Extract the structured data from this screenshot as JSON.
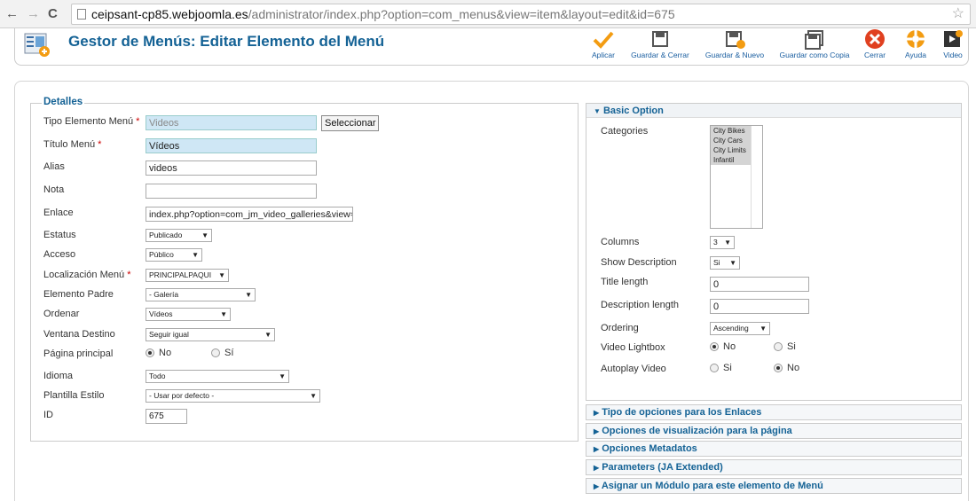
{
  "browser": {
    "url_host": "ceipsant-cp85.webjoomla.es",
    "url_path": "/administrator/index.php?option=com_menus&view=item&layout=edit&id=675"
  },
  "header": {
    "title": "Gestor de Menús: Editar Elemento del Menú",
    "toolbar": {
      "apply": "Aplicar",
      "save_close": "Guardar & Cerrar",
      "save_new": "Guardar & Nuevo",
      "save_copy": "Guardar como Copia",
      "close": "Cerrar",
      "help": "Ayuda",
      "video": "Video"
    }
  },
  "details": {
    "legend": "Detalles",
    "menu_item_type": {
      "label": "Tipo Elemento Menú",
      "value": "Videos",
      "button": "Seleccionar"
    },
    "menu_title": {
      "label": "Título Menú",
      "value": "Vídeos"
    },
    "alias": {
      "label": "Alias",
      "value": "videos"
    },
    "note": {
      "label": "Nota",
      "value": ""
    },
    "link": {
      "label": "Enlace",
      "value": "index.php?option=com_jm_video_galleries&view=i"
    },
    "status": {
      "label": "Estatus",
      "value": "Publicado"
    },
    "access": {
      "label": "Acceso",
      "value": "Público"
    },
    "menu_location": {
      "label": "Localización Menú",
      "value": "PRINCIPALPAQUI"
    },
    "parent_item": {
      "label": "Elemento Padre",
      "value": "- Galería"
    },
    "ordering": {
      "label": "Ordenar",
      "value": "Vídeos"
    },
    "target_window": {
      "label": "Ventana Destino",
      "value": "Seguir igual"
    },
    "home_page": {
      "label": "Página principal",
      "no": "No",
      "yes": "Sí",
      "selected": "No"
    },
    "language": {
      "label": "Idioma",
      "value": "Todo"
    },
    "template_style": {
      "label": "Plantilla Estilo",
      "value": "- Usar por defecto -"
    },
    "id": {
      "label": "ID",
      "value": "675"
    },
    "required_mark": "*"
  },
  "basic_option": {
    "title": "Basic Option",
    "categories": {
      "label": "Categories",
      "items": [
        "City Bikes",
        "City Cars",
        "City Limits",
        "Infantil"
      ]
    },
    "columns": {
      "label": "Columns",
      "value": "3"
    },
    "show_description": {
      "label": "Show Description",
      "value": "Si"
    },
    "title_length": {
      "label": "Title length",
      "value": "0"
    },
    "description_length": {
      "label": "Description length",
      "value": "0"
    },
    "ordering": {
      "label": "Ordering",
      "value": "Ascending"
    },
    "video_lightbox": {
      "label": "Video Lightbox",
      "no": "No",
      "yes": "Si",
      "selected": "No"
    },
    "autoplay_video": {
      "label": "Autoplay Video",
      "yes": "Si",
      "no": "No",
      "selected": "No"
    }
  },
  "accordion": [
    "Tipo de opciones para los Enlaces",
    "Opciones de visualización para la página",
    "Opciones Metadatos",
    "Parameters (JA Extended)",
    "Asignar un Módulo para este elemento de Menú"
  ]
}
